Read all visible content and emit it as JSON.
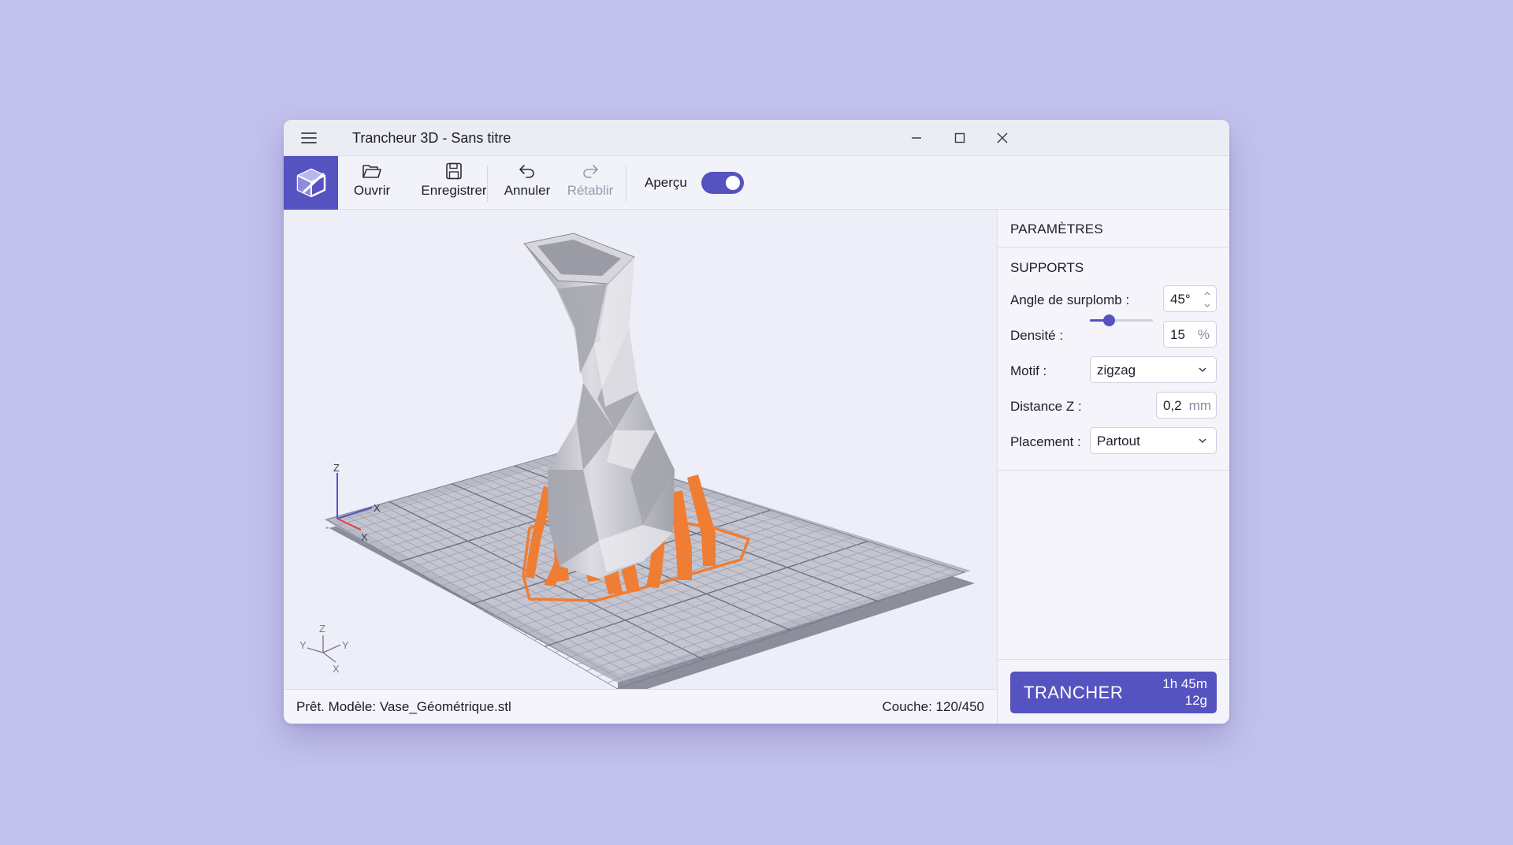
{
  "window": {
    "title": "Trancheur 3D - Sans titre"
  },
  "toolbar": {
    "open_label": "Ouvrir",
    "save_label": "Enregistrer",
    "undo_label": "Annuler",
    "redo_label": "Rétablir",
    "preview_label": "Aperçu",
    "preview_enabled": true
  },
  "viewport": {
    "axis_gizmo": {
      "z": "Z",
      "x_label": "X",
      "x_label2": "X"
    },
    "orientation_gizmo": {
      "z": "Z",
      "y": "Y",
      "y2": "Y",
      "x": "X"
    },
    "model_color": "#bfbfc6",
    "support_color": "#ef7d34"
  },
  "status": {
    "message": "Prêt. Modèle: Vase_Géométrique.stl",
    "layer": "Couche: 120/450"
  },
  "panel": {
    "title": "PARAMÈTRES",
    "section": "SUPPORTS",
    "overhang_label": "Angle de surplomb :",
    "overhang_value": "45°",
    "density_label": "Densité :",
    "density_value": "15",
    "density_unit": "%",
    "density_fraction": 0.3,
    "pattern_label": "Motif :",
    "pattern_value": "zigzag",
    "zdistance_label": "Distance Z :",
    "zdistance_value": "0,2",
    "zdistance_unit": "mm",
    "placement_label": "Placement :",
    "placement_value": "Partout"
  },
  "slice": {
    "label": "TRANCHER",
    "time": "1h 45m",
    "weight": "12g"
  },
  "colors": {
    "accent": "#5553c0",
    "background": "#c3c2ed"
  }
}
